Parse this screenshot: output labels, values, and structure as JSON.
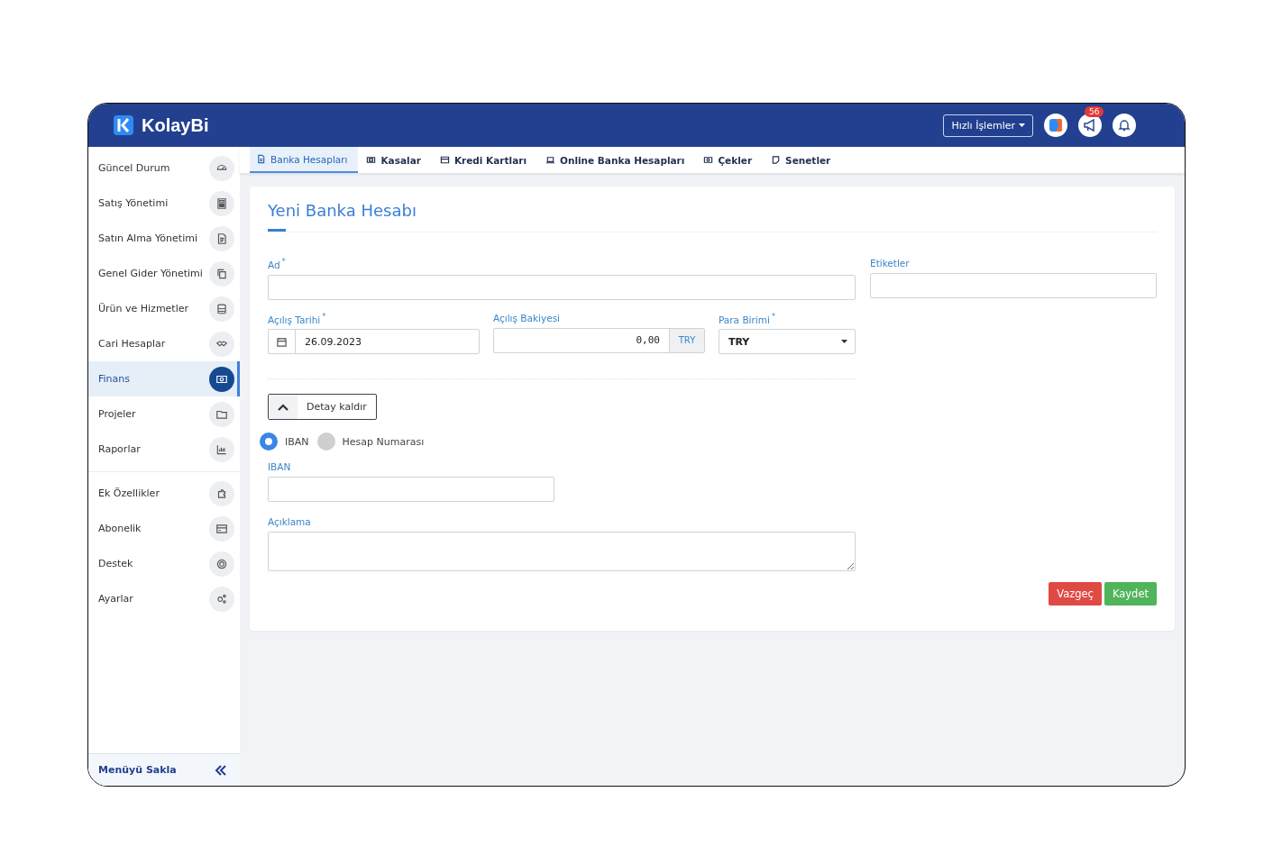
{
  "header": {
    "logo": "KolayBi",
    "quick_actions": "Hızlı İşlemler",
    "notification_count": "56"
  },
  "sidebar": {
    "groups": [
      [
        {
          "label": "Güncel Durum",
          "selected": false
        },
        {
          "label": "Satış Yönetimi",
          "selected": false
        },
        {
          "label": "Satın Alma Yönetimi",
          "selected": false
        },
        {
          "label": "Genel Gider Yönetimi",
          "selected": false
        },
        {
          "label": "Ürün ve Hizmetler",
          "selected": false
        },
        {
          "label": "Cari Hesaplar",
          "selected": false
        },
        {
          "label": "Finans",
          "selected": true
        },
        {
          "label": "Projeler",
          "selected": false
        },
        {
          "label": "Raporlar",
          "selected": false
        }
      ],
      [
        {
          "label": "Ek Özellikler",
          "selected": false
        },
        {
          "label": "Abonelik",
          "selected": false
        },
        {
          "label": "Destek",
          "selected": false
        },
        {
          "label": "Ayarlar",
          "selected": false
        }
      ]
    ],
    "footer": "Menüyü Sakla"
  },
  "tabs": [
    {
      "label": "Banka Hesapları",
      "selected": true
    },
    {
      "label": "Kasalar",
      "selected": false
    },
    {
      "label": "Kredi Kartları",
      "selected": false
    },
    {
      "label": "Online Banka Hesapları",
      "selected": false
    },
    {
      "label": "Çekler",
      "selected": false
    },
    {
      "label": "Senetler",
      "selected": false
    }
  ],
  "form": {
    "title": "Yeni Banka Hesabı",
    "name": {
      "label": "Ad",
      "required_mark": "*"
    },
    "tags": {
      "label": "Etiketler"
    },
    "opening_date": {
      "label": "Açılış Tarihi",
      "required_mark": "*",
      "value": "26.09.2023"
    },
    "opening_balance": {
      "label": "Açılış Bakiyesi",
      "value": "0,00",
      "addon": "TRY"
    },
    "currency": {
      "label": "Para Birimi",
      "required_mark": "*",
      "value": "TRY"
    },
    "detail_button": "Detay kaldır",
    "account_type": [
      {
        "label": "IBAN",
        "selected": true
      },
      {
        "label": "Hesap Numarası",
        "selected": false
      }
    ],
    "iban": {
      "label": "IBAN"
    },
    "description": {
      "label": "Açıklama"
    },
    "buttons": {
      "cancel": "Vazgeç",
      "save": "Kaydet"
    }
  }
}
